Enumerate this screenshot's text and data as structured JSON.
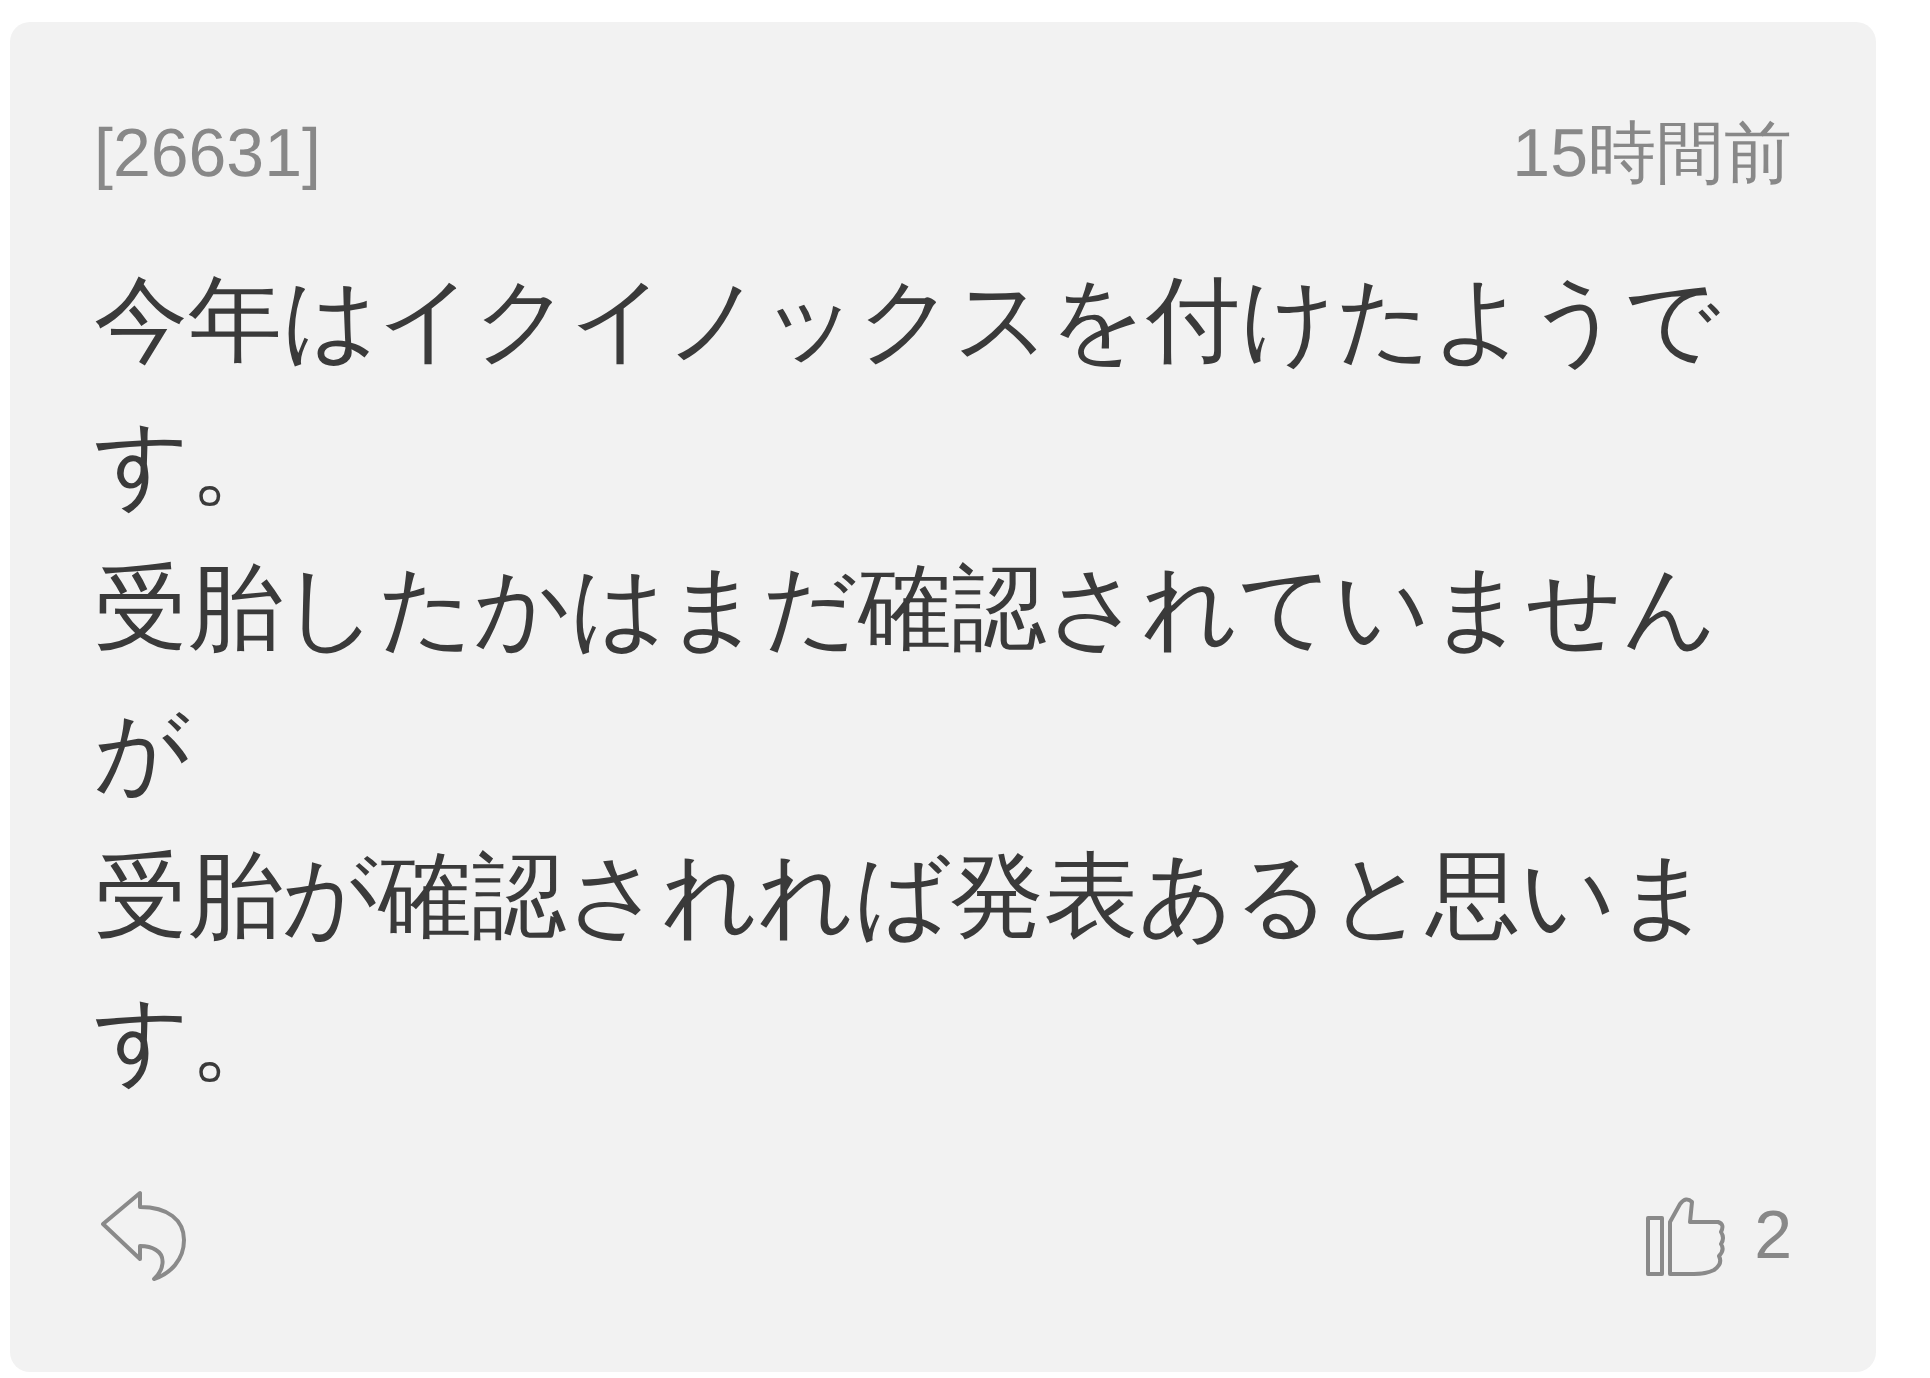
{
  "comment": {
    "number": "[26631]",
    "time": "15時間前",
    "paragraphs": [
      "今年はイクイノックスを付けたようです。",
      "受胎したかはまだ確認されていませんが",
      "受胎が確認されれば発表あると思います。"
    ],
    "like_count": "2"
  }
}
